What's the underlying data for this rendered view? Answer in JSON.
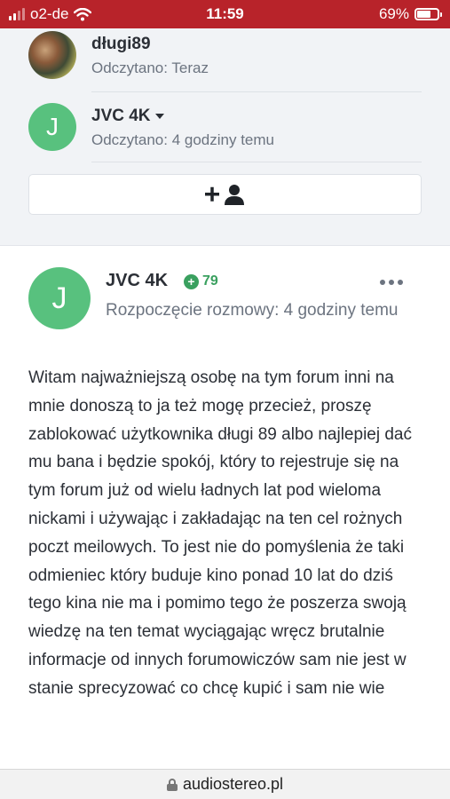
{
  "status_bar": {
    "carrier": "o2-de",
    "time": "11:59",
    "battery": "69%",
    "battery_level": 0.69
  },
  "participants": [
    {
      "name": "długi89",
      "status": "Odczytano: Teraz",
      "avatar": "photo"
    },
    {
      "name": "JVC 4K",
      "status": "Odczytano: 4 godziny temu",
      "avatar_letter": "J"
    }
  ],
  "add_participant_icon": "add-user-icon",
  "message": {
    "avatar_letter": "J",
    "author": "JVC 4K",
    "reputation": "79",
    "meta": "Rozpoczęcie rozmowy: 4 godziny temu",
    "body": "Witam najważniejszą osobę na tym forum inni na mnie donoszą to ja też mogę przecież, proszę zablokować użytkownika długi 89 albo najlepiej dać mu bana i będzie spokój, który to rejestruje się na tym forum już od wielu ładnych lat pod wieloma nickami i używając i zakładając na ten cel rożnych poczt meilowych. To jest nie do pomyślenia że taki odmieniec który buduje kino ponad 10 lat do dziś tego kina nie ma i pomimo tego że poszerza swoją wiedzę na ten temat wyciągając wręcz brutalnie informacje od innych forumowiczów sam nie jest w stanie sprecyzować co chcę kupić i sam nie wie"
  },
  "url_bar": {
    "domain": "audiostereo.pl"
  },
  "colors": {
    "status_bar": "#b8232a",
    "avatar_green": "#58c17e",
    "reputation_green": "#3aa05f"
  }
}
